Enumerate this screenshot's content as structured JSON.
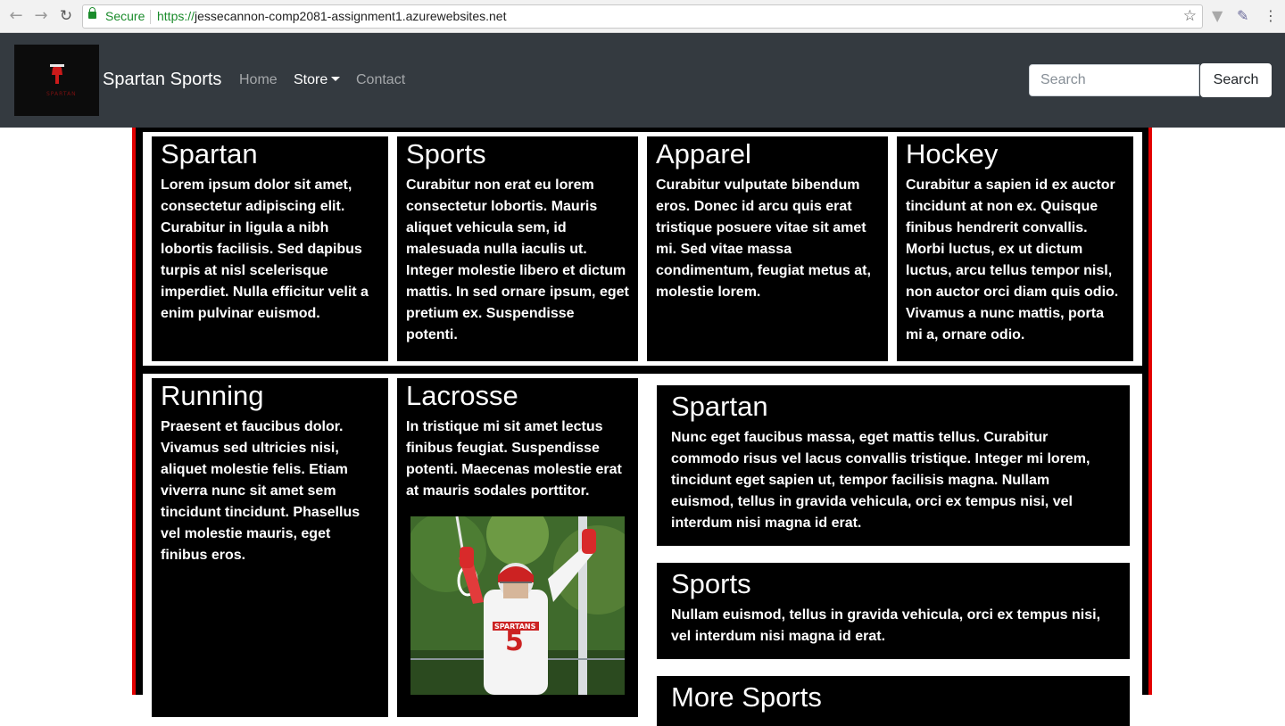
{
  "browser": {
    "secure_label": "Secure",
    "url_scheme": "https://",
    "url_host": "jessecannon-comp2081-assignment1.azurewebsites.net"
  },
  "navbar": {
    "brand": "Spartan Sports",
    "links": [
      {
        "label": "Home"
      },
      {
        "label": "Store"
      },
      {
        "label": "Contact"
      }
    ],
    "search_placeholder": "Search",
    "search_button": "Search",
    "logo_text": "SPARTAN"
  },
  "row1": [
    {
      "title": "Spartan",
      "text": "Lorem ipsum dolor sit amet, consectetur adipiscing elit. Curabitur in ligula a nibh lobortis facilisis. Sed dapibus turpis at nisl scelerisque imperdiet. Nulla efficitur velit a enim pulvinar euismod."
    },
    {
      "title": "Sports",
      "text": "Curabitur non erat eu lorem consectetur lobortis. Mauris aliquet vehicula sem, id malesuada nulla iaculis ut. Integer molestie libero et dictum mattis. In sed ornare ipsum, eget pretium ex. Suspendisse potenti."
    },
    {
      "title": "Apparel",
      "text": "Curabitur vulputate bibendum eros. Donec id arcu quis erat tristique posuere vitae sit amet mi. Sed vitae massa condimentum, feugiat metus at, molestie lorem."
    },
    {
      "title": "Hockey",
      "text": "Curabitur a sapien id ex auctor tincidunt at non ex. Quisque finibus hendrerit convallis. Morbi luctus, ex ut dictum luctus, arcu tellus tempor nisl, non auctor orci diam quis odio. Vivamus a nunc mattis, porta mi a, ornare odio."
    }
  ],
  "row2": {
    "running": {
      "title": "Running",
      "text": "Praesent et faucibus dolor. Vivamus sed ultricies nisi, aliquet molestie felis. Etiam viverra nunc sit amet sem tincidunt tincidunt. Phasellus vel molestie mauris, eget finibus eros."
    },
    "lacrosse": {
      "title": "Lacrosse",
      "text": "In tristique mi sit amet lectus finibus feugiat. Suspendisse potenti. Maecenas molestie erat at mauris sodales porttitor.",
      "jersey_text": "SPARTANS",
      "jersey_number": "5"
    },
    "boxes": [
      {
        "title": "Spartan",
        "text": "Nunc eget faucibus massa, eget mattis tellus. Curabitur commodo risus vel lacus convallis tristique. Integer mi lorem, tincidunt eget sapien ut, tempor facilisis magna. Nullam euismod, tellus in gravida vehicula, orci ex tempus nisi, vel interdum nisi magna id erat."
      },
      {
        "title": "Sports",
        "text": "Nullam euismod, tellus in gravida vehicula, orci ex tempus nisi, vel interdum nisi magna id erat."
      },
      {
        "title": "More Sports",
        "text": ""
      }
    ]
  },
  "colors": {
    "navbar_bg": "#343a40",
    "accent_red": "#e30000",
    "card_bg": "#000000",
    "secure_green": "#1a8b2b"
  }
}
